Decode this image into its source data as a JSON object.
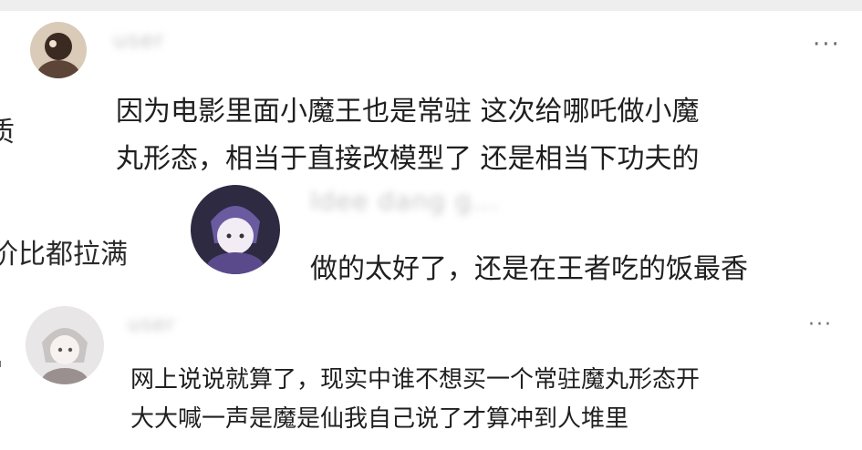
{
  "side_texts": {
    "top_fragment": "质",
    "mid_fragment": "价比都拉满",
    "bottom_fragment": "'"
  },
  "comments": [
    {
      "username": "user",
      "more_label": "···",
      "lines": [
        "因为电影里面小魔王也是常驻 这次给哪吒做小魔",
        "丸形态，相当于直接改模型了 还是相当下功夫的"
      ]
    },
    {
      "username": "Idee dang g...",
      "lines": [
        "做的太好了，还是在王者吃的饭最香"
      ]
    },
    {
      "username": "user",
      "more_label": "···",
      "lines": [
        "网上说说就算了，现实中谁不想买一个常驻魔丸形态开",
        "大大喊一声是魔是仙我自己说了才算冲到人堆里"
      ]
    }
  ]
}
